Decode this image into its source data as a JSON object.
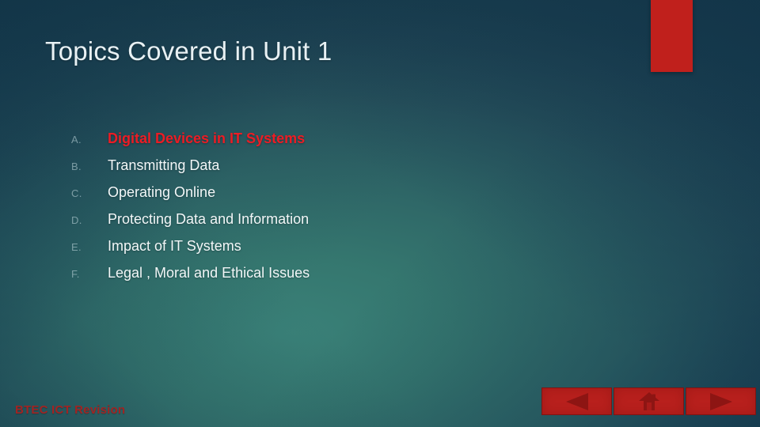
{
  "slide": {
    "title": "Topics Covered in Unit 1",
    "footer": "BTEC ICT Revision",
    "accent_color": "#c0201c",
    "highlight_color": "#ec1c24",
    "body_text_color": "#f2f7f8",
    "background_colors": [
      "#1a3f51",
      "#3a8178"
    ]
  },
  "topics": [
    {
      "marker": "A.",
      "label": "Digital Devices in IT Systems",
      "highlighted": true
    },
    {
      "marker": "B.",
      "label": "Transmitting Data",
      "highlighted": false
    },
    {
      "marker": "C.",
      "label": "Operating Online",
      "highlighted": false
    },
    {
      "marker": "D.",
      "label": "Protecting Data and Information",
      "highlighted": false
    },
    {
      "marker": "E.",
      "label": "Impact of IT Systems",
      "highlighted": false
    },
    {
      "marker": "F.",
      "label": "Legal , Moral and Ethical Issues",
      "highlighted": false
    }
  ],
  "nav": {
    "buttons": [
      {
        "icon": "previous-arrow-icon",
        "name": "previous-slide-button"
      },
      {
        "icon": "home-icon",
        "name": "home-button"
      },
      {
        "icon": "next-arrow-icon",
        "name": "next-slide-button"
      }
    ]
  }
}
